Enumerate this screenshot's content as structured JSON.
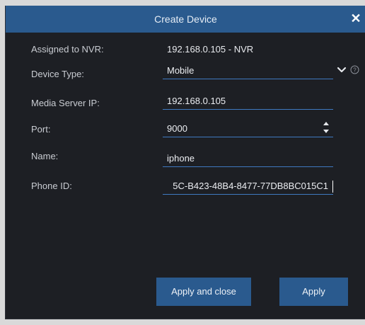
{
  "dialog": {
    "title": "Create Device",
    "close_icon": "close-icon"
  },
  "form": {
    "nvr": {
      "label": "Assigned to NVR:",
      "value": "192.168.0.105 - NVR"
    },
    "device_type": {
      "label": "Device Type:",
      "value": "Mobile"
    },
    "media_server_ip": {
      "label": "Media Server IP:",
      "value": "192.168.0.105"
    },
    "port": {
      "label": "Port:",
      "value": "9000"
    },
    "name": {
      "label": "Name:",
      "value": "iphone"
    },
    "phone_id": {
      "label": "Phone ID:",
      "value": "5C-B423-48B4-8477-77DB8BC015C1"
    }
  },
  "buttons": {
    "apply_and_close": "Apply and close",
    "apply": "Apply"
  },
  "icons": {
    "dropdown": "chevron-down-icon",
    "help": "help-icon",
    "spinner": "spinner-arrows-icon"
  },
  "colors": {
    "accent": "#2a5a8e",
    "field_underline": "#3f79c0",
    "background": "#1d1f24"
  }
}
